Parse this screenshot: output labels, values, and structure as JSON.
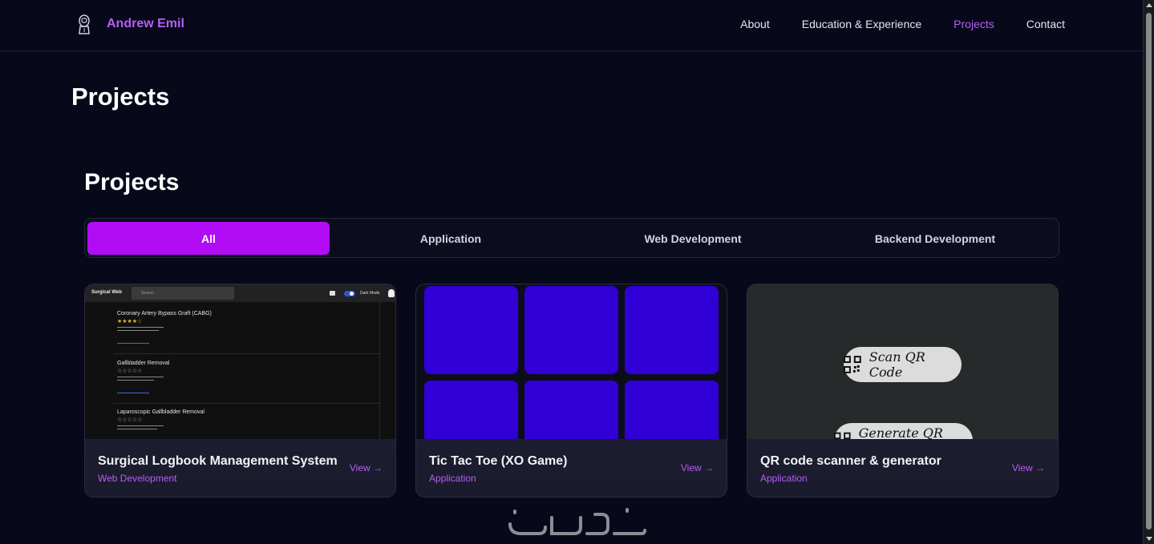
{
  "header": {
    "brand_name": "Andrew Emil",
    "nav": [
      {
        "label": "About",
        "active": false
      },
      {
        "label": "Education & Experience",
        "active": false
      },
      {
        "label": "Projects",
        "active": true
      },
      {
        "label": "Contact",
        "active": false
      }
    ]
  },
  "page_title": "Projects",
  "section_title": "Projects",
  "tabs": [
    {
      "label": "All",
      "active": true
    },
    {
      "label": "Application",
      "active": false
    },
    {
      "label": "Web Development",
      "active": false
    },
    {
      "label": "Backend Development",
      "active": false
    }
  ],
  "cards": [
    {
      "title": "Surgical Logbook Management System",
      "category": "Web Development",
      "view_label": "View →",
      "thumb": {
        "app_name": "Surgical Web",
        "search_placeholder": "Search",
        "mode_label": "Dark Mode",
        "items": [
          {
            "name": "Coronary Artery Bypass Graft (CABG)",
            "stars": "★★★★☆"
          },
          {
            "name": "Gallbladder Removal",
            "stars": "☆☆☆☆☆"
          },
          {
            "name": "Laparoscopic Gallbladder Removal",
            "stars": "☆☆☆☆☆"
          }
        ]
      }
    },
    {
      "title": "Tic Tac Toe (XO Game)",
      "category": "Application",
      "view_label": "View →"
    },
    {
      "title": "QR code scanner & generator",
      "category": "Application",
      "view_label": "View →",
      "thumb": {
        "scan_label": "Scan QR Code",
        "generate_label": "Generate QR Code"
      }
    }
  ],
  "colors": {
    "accent": "#b65ef5",
    "tab_active": "#b10cf5",
    "background": "#07081a",
    "ttt_cell": "#3000d6"
  }
}
